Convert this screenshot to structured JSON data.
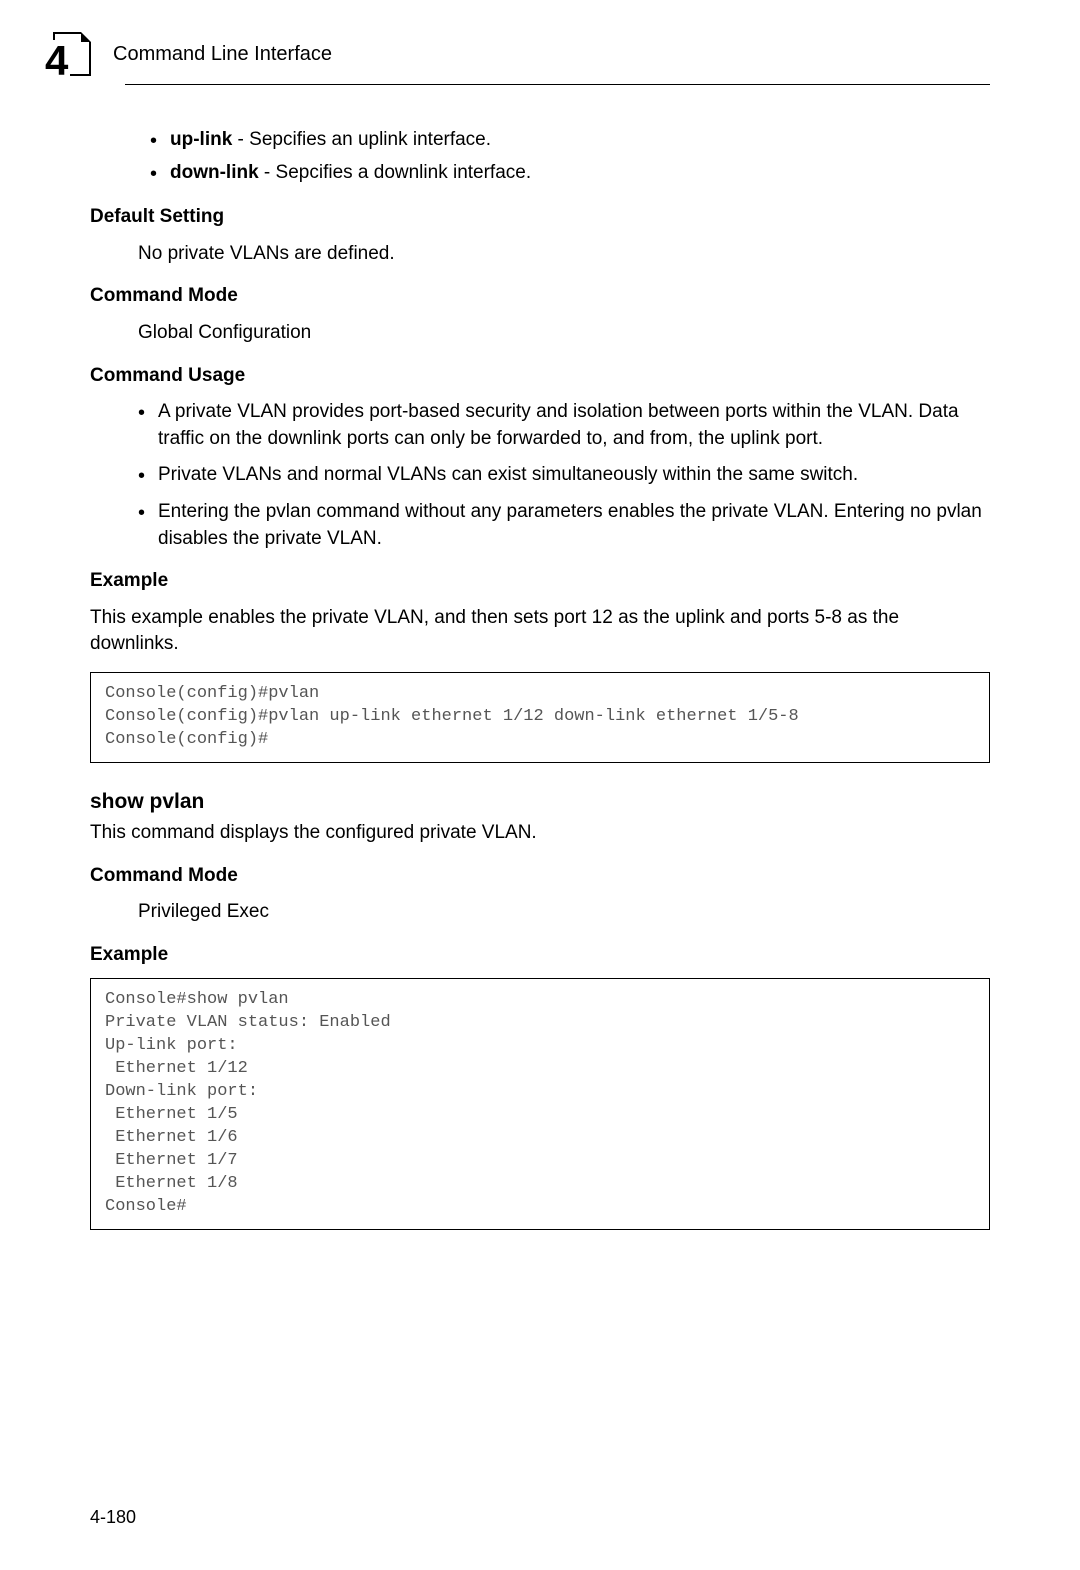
{
  "header": {
    "chapter_number": "4",
    "title": "Command Line Interface"
  },
  "param_bullets": {
    "uplink_label": "up-link",
    "uplink_desc": " - Sepcifies an uplink interface.",
    "downlink_label": "down-link",
    "downlink_desc": " - Sepcifies a downlink interface."
  },
  "default_setting": {
    "heading": "Default Setting",
    "text": "No private VLANs are defined."
  },
  "command_mode1": {
    "heading": "Command Mode",
    "text": "Global Configuration"
  },
  "command_usage": {
    "heading": "Command Usage",
    "b1": "A private VLAN provides port-based security and isolation between ports within the VLAN. Data traffic on the downlink ports can only be forwarded to, and from, the uplink port.",
    "b2": "Private VLANs and normal VLANs can exist simultaneously within the same switch.",
    "b3": "Entering the pvlan command without any parameters enables the private VLAN. Entering no pvlan disables the private VLAN."
  },
  "example1": {
    "heading": "Example",
    "intro": "This example enables the private VLAN, and then sets port 12 as the uplink and ports 5-8 as the downlinks.",
    "code": "Console(config)#pvlan\nConsole(config)#pvlan up-link ethernet 1/12 down-link ethernet 1/5-8\nConsole(config)#"
  },
  "show_pvlan": {
    "title": "show pvlan",
    "desc": "This command displays the configured private VLAN."
  },
  "command_mode2": {
    "heading": "Command Mode",
    "text": "Privileged Exec"
  },
  "example2": {
    "heading": "Example",
    "code": "Console#show pvlan\nPrivate VLAN status: Enabled\nUp-link port:\n Ethernet 1/12\nDown-link port:\n Ethernet 1/5\n Ethernet 1/6\n Ethernet 1/7\n Ethernet 1/8\nConsole#"
  },
  "page_number": "4-180"
}
